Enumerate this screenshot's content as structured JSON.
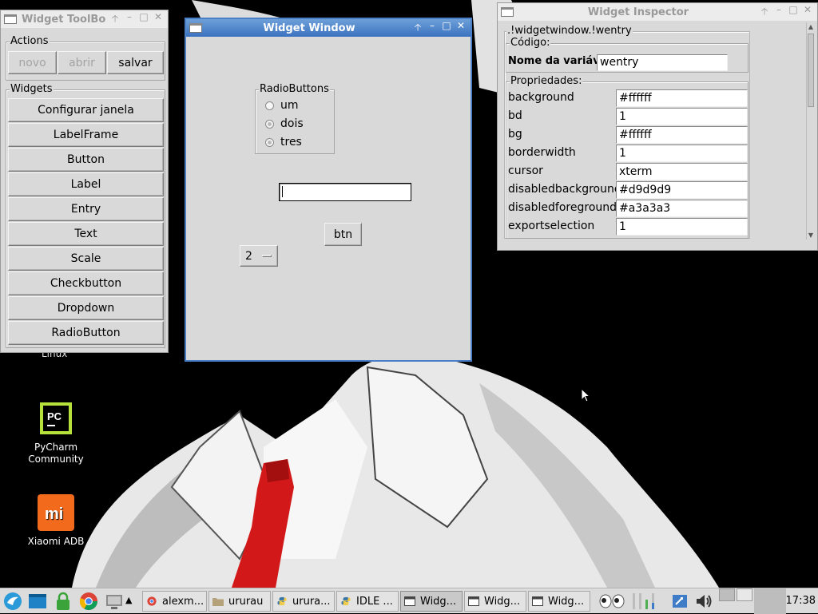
{
  "desktop": {
    "partial_label": "Linux",
    "icons": [
      {
        "label_line1": "PyCharm",
        "label_line2": "Community",
        "icon": "pycharm-icon"
      },
      {
        "label_line1": "Xiaomi ADB",
        "label_line2": "",
        "icon": "xiaomi-icon"
      }
    ]
  },
  "toolbox": {
    "title": "Widget ToolBo",
    "actions_label": "Actions",
    "actions": [
      {
        "label": "novo",
        "enabled": false
      },
      {
        "label": "abrir",
        "enabled": false
      },
      {
        "label": "salvar",
        "enabled": true
      }
    ],
    "widgets_label": "Widgets",
    "widgets": [
      "Configurar janela",
      "LabelFrame",
      "Button",
      "Label",
      "Entry",
      "Text",
      "Scale",
      "Checkbutton",
      "Dropdown",
      "RadioButton"
    ]
  },
  "widget_window": {
    "title": "Widget Window",
    "radio_frame_label": "RadioButtons",
    "radios": [
      "um",
      "dois",
      "tres"
    ],
    "entry_value": "",
    "button_label": "btn",
    "dropdown_value": "2"
  },
  "inspector": {
    "title": "Widget Inspector",
    "path_label": ".!widgetwindow.!wentry",
    "code_label": "Código:",
    "varname_label": "Nome da variável",
    "varname_value": "wentry",
    "props_label": "Propriedades:",
    "properties": [
      {
        "name": "background",
        "value": "#ffffff"
      },
      {
        "name": "bd",
        "value": "1"
      },
      {
        "name": "bg",
        "value": "#ffffff"
      },
      {
        "name": "borderwidth",
        "value": "1"
      },
      {
        "name": "cursor",
        "value": "xterm"
      },
      {
        "name": "disabledbackground",
        "value": "#d9d9d9"
      },
      {
        "name": "disabledforeground",
        "value": "#a3a3a3"
      },
      {
        "name": "exportselection",
        "value": "1"
      }
    ]
  },
  "taskbar": {
    "tasks": [
      {
        "label": "alexm...",
        "icon": "chrome-icon"
      },
      {
        "label": "ururau",
        "icon": "folder-icon"
      },
      {
        "label": "urura...",
        "icon": "python-icon"
      },
      {
        "label": "IDLE ...",
        "icon": "python-icon"
      },
      {
        "label": "Widg...",
        "icon": "window-icon"
      },
      {
        "label": "Widg...",
        "icon": "window-icon"
      },
      {
        "label": "Widg...",
        "icon": "window-icon"
      }
    ],
    "clock": "17:38"
  },
  "colors": {
    "titlebar_active": "#3b72c0",
    "window_bg": "#d9d9d9",
    "tie_red": "#d21818"
  }
}
